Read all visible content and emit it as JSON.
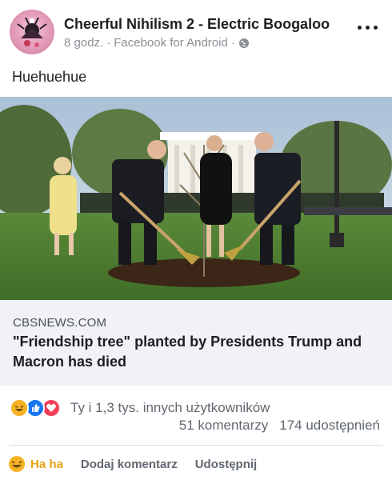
{
  "post": {
    "page_name": "Cheerful Nihilism 2 - Electric Boogaloo",
    "time": "8 godz.",
    "via": "Facebook for Android",
    "sep": "·",
    "text": "Huehuehue"
  },
  "link_card": {
    "domain": "CBSNEWS.COM",
    "headline": "\"Friendship tree\" planted by Presidents Trump and Macron has died"
  },
  "reactions": {
    "summary": "Ty i 1,3 tys. innych użytkowników",
    "comments": "51 komentarzy",
    "shares": "174 udostępnień",
    "icons": [
      "haha-icon",
      "like-icon",
      "love-icon"
    ]
  },
  "actions": {
    "reaction_label": "Ha ha",
    "comment_label": "Dodaj komentarz",
    "share_label": "Udostępnij"
  },
  "colors": {
    "haha": "#f7b125",
    "like": "#1877f2",
    "love": "#f33e58",
    "active_reaction_text": "#e6a316"
  }
}
